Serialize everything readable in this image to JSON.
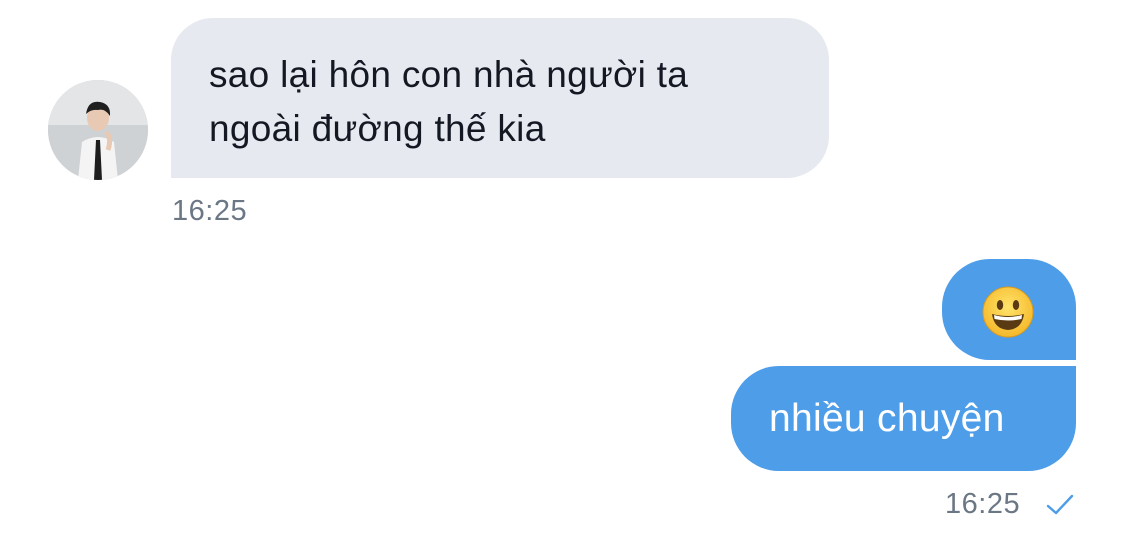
{
  "messages": [
    {
      "direction": "incoming",
      "lines": [
        "sao lại hôn con nhà người ta",
        "ngoài đường thế kia"
      ],
      "time": "16:25",
      "avatar_icon": "contact-avatar-photo"
    },
    {
      "direction": "outgoing",
      "emoji_icon": "grinning-face-emoji"
    },
    {
      "direction": "outgoing",
      "text": "nhiều chuyện",
      "time": "16:25",
      "status_icon": "sent-check-icon"
    }
  ],
  "colors": {
    "incoming_bubble": "#e6e9ef",
    "outgoing_bubble": "#4d9de9",
    "timestamp": "#6b7785",
    "incoming_text": "#141823",
    "outgoing_text": "#ffffff"
  }
}
